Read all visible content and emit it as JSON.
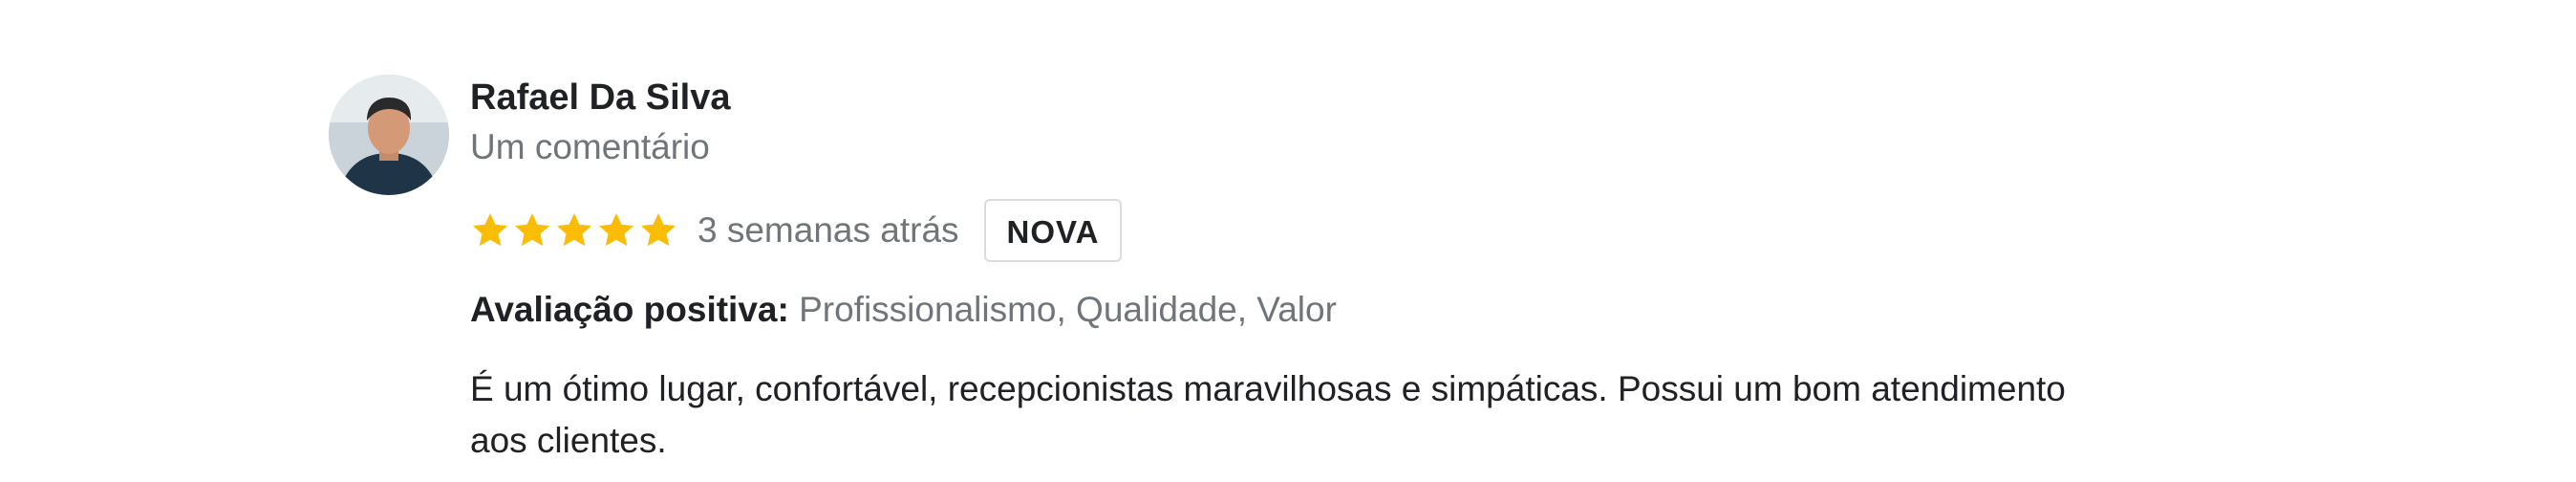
{
  "review": {
    "author": "Rafael Da Silva",
    "author_meta": "Um comentário",
    "rating": 5,
    "rating_max": 5,
    "star_color": "#fbbc04",
    "time": "3 semanas atrás",
    "badge": "NOVA",
    "positive_label": "Avaliação positiva:",
    "positive_values": "Profissionalismo, Qualidade, Valor",
    "text_line1": "É um ótimo lugar, confortável, recepcionistas maravilhosas e simpáticas. Possui um bom atendimento",
    "text_line2": "aos clientes."
  }
}
